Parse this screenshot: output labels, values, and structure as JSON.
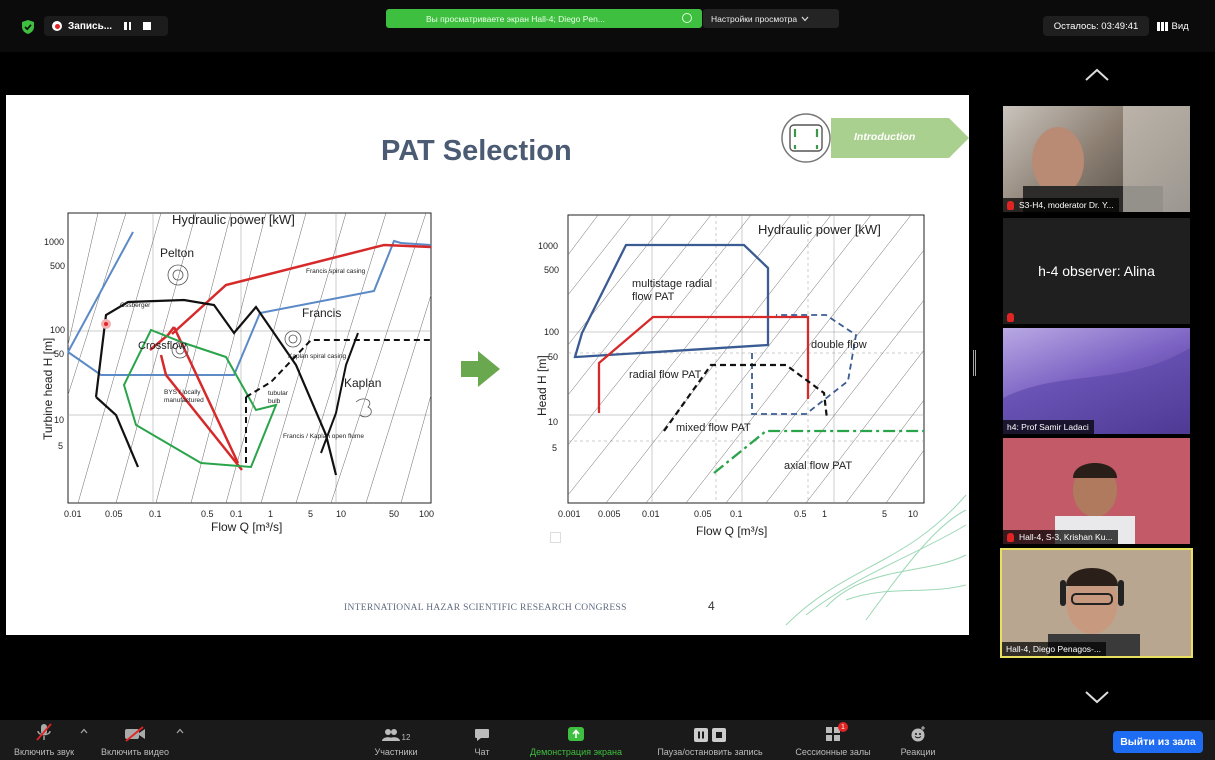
{
  "top_bar": {
    "recording_label": "Запись...",
    "share_banner": "Вы просматриваете экран Hall-4; Diego Pen...",
    "view_options": "Настройки просмотра",
    "timer": "Осталось: 03:49:41",
    "view_button": "Вид"
  },
  "slide": {
    "title": "PAT Selection",
    "badge": "Introduction",
    "footer": "INTERNATIONAL HAZAR SCIENTIFIC RESEARCH CONGRESS",
    "page_number": "4"
  },
  "chart_data": [
    {
      "type": "region-chart",
      "title": "Hydraulic power [kW]",
      "xlabel": "Flow Q [m³/s]",
      "ylabel": "Turbine head H [m]",
      "x_scale": "log",
      "y_scale": "log",
      "x_ticks": [
        "0.01",
        "0.05",
        "0.1",
        "0.5",
        "0.1",
        "1",
        "5",
        "10",
        "50",
        "100"
      ],
      "y_ticks": [
        "1000",
        "500",
        "100",
        "50",
        "10",
        "5"
      ],
      "regions": [
        {
          "name": "Pelton"
        },
        {
          "name": "Francis"
        },
        {
          "name": "Crossflow"
        },
        {
          "name": "Kaplan"
        }
      ],
      "annotations": [
        "Ossberger",
        "Francis spiral casing",
        "Kaplan spiral casing",
        "BYS / locally manufactured",
        "tubular bulb",
        "Francis / Kaplan open flume"
      ]
    },
    {
      "type": "region-chart",
      "title": "Hydraulic power [kW]",
      "xlabel": "Flow Q [m³/s]",
      "ylabel": "Head H [m]",
      "x_scale": "log",
      "y_scale": "log",
      "x_ticks": [
        "0.001",
        "0.005",
        "0.01",
        "0.05",
        "0.1",
        "0.5",
        "1",
        "5",
        "10"
      ],
      "y_ticks": [
        "1000",
        "500",
        "100",
        "50",
        "10",
        "5"
      ],
      "regions": [
        {
          "name": "multistage radial flow PAT"
        },
        {
          "name": "radial flow PAT"
        },
        {
          "name": "double flow"
        },
        {
          "name": "mixed flow PAT"
        },
        {
          "name": "axial flow PAT"
        }
      ]
    }
  ],
  "participants": [
    {
      "name": "S3-H4, moderator Dr. Y...",
      "muted": true
    },
    {
      "name": "h-4 observer: Alina",
      "muted": true
    },
    {
      "name": "h4: Prof Samir Ladaci",
      "muted": false
    },
    {
      "name": "Hall-4, S-3, Krishan Ku...",
      "muted": true
    },
    {
      "name": "Hall-4, Diego Penagos-...",
      "muted": false,
      "active_speaker": true
    }
  ],
  "toolbar": {
    "mic": "Включить звук",
    "video": "Включить видео",
    "participants": "Участники",
    "participants_count": "12",
    "chat": "Чат",
    "share": "Демонстрация экрана",
    "record": "Пауза/остановить запись",
    "breakout": "Сессионные залы",
    "breakout_badge": "1",
    "reactions": "Реакции",
    "leave": "Выйти из зала"
  },
  "colors": {
    "share_green": "#3fbf3f",
    "leave_blue": "#1e6cf2",
    "active_border": "#e9e060",
    "slide_title": "#4a5b73"
  }
}
